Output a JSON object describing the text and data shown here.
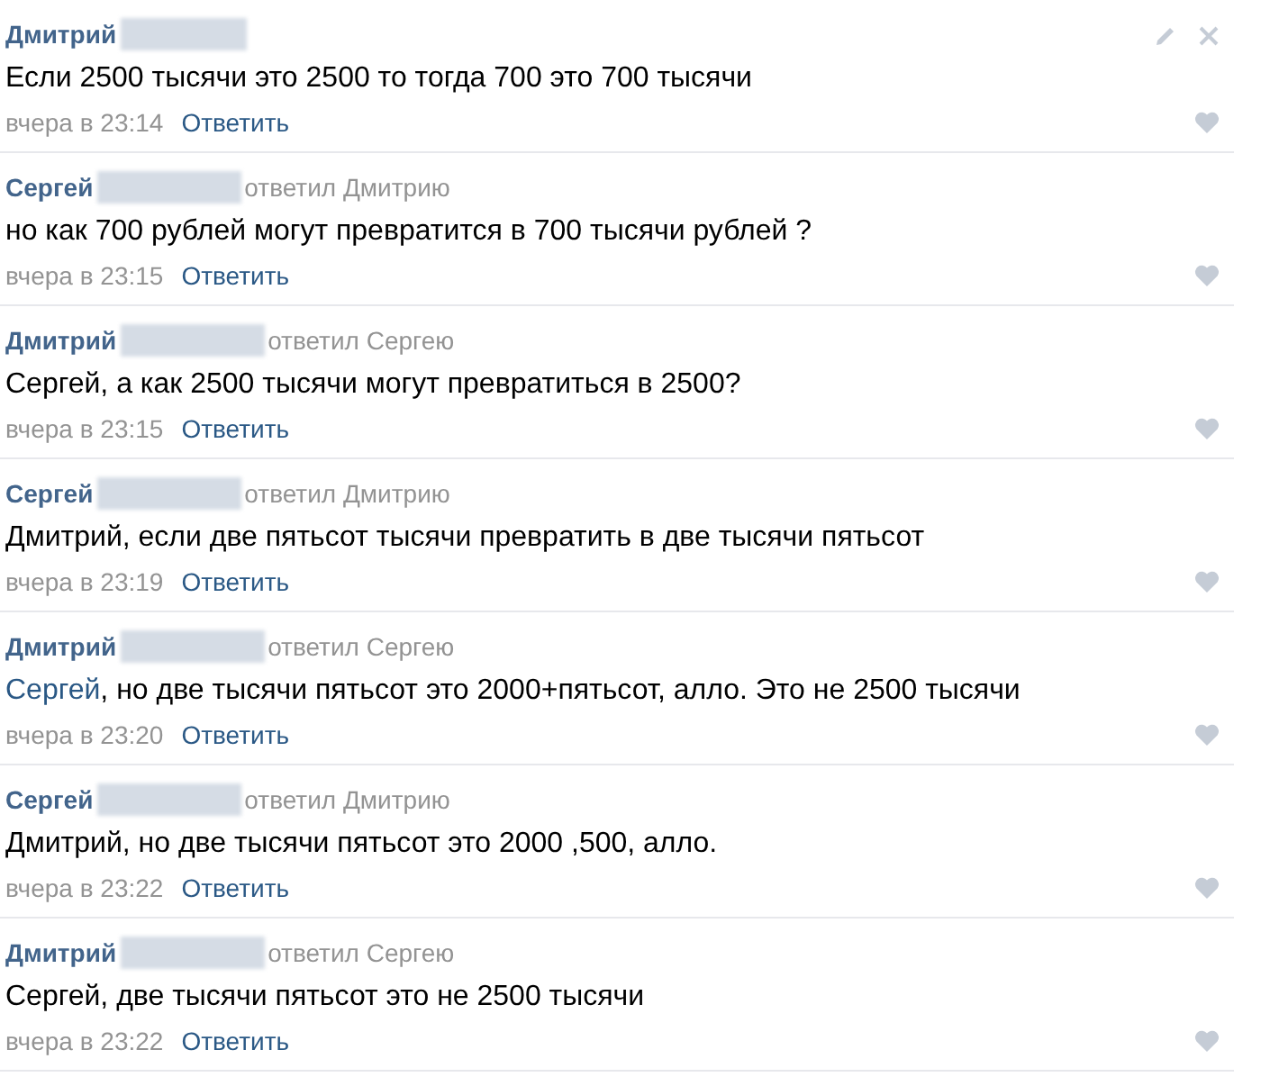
{
  "comments": [
    {
      "author": "Дмитрий",
      "text": "Если 2500 тысячи это 2500 то тогда 700 это 700 тысячи",
      "time": "вчера в 23:14",
      "reply_label": "Ответить",
      "editable": true,
      "liked": false
    },
    {
      "author": "Сергей",
      "reply_to": "ответил Дмитрию",
      "text": "но как 700 рублей могут превратится в 700 тысячи рублей ?",
      "time": "вчера в 23:15",
      "reply_label": "Ответить",
      "editable": false,
      "liked": false
    },
    {
      "author": "Дмитрий",
      "reply_to": "ответил Сергею",
      "text": "Сергей, а как 2500 тысячи могут превратиться в 2500?",
      "time": "вчера в 23:15",
      "reply_label": "Ответить",
      "editable": false,
      "liked": false
    },
    {
      "author": "Сергей",
      "reply_to": "ответил Дмитрию",
      "text": "Дмитрий, если две пятьсот тысячи превратить в две тысячи пятьсот",
      "time": "вчера в 23:19",
      "reply_label": "Ответить",
      "editable": false,
      "liked": false
    },
    {
      "author": "Дмитрий",
      "reply_to": "ответил Сергею",
      "mention": "Сергей",
      "text": ", но две тысячи пятьсот это 2000+пятьсот, алло. Это не 2500 тысячи",
      "time": "вчера в 23:20",
      "reply_label": "Ответить",
      "editable": false,
      "liked": false
    },
    {
      "author": "Сергей",
      "reply_to": "ответил Дмитрию",
      "text": "Дмитрий, но две тысячи пятьсот это 2000 ,500, алло.",
      "time": "вчера в 23:22",
      "reply_label": "Ответить",
      "editable": false,
      "liked": false
    },
    {
      "author": "Дмитрий",
      "reply_to": "ответил Сергею",
      "text": "Сергей, две тысячи пятьсот это не 2500 тысячи",
      "time": "вчера в 23:22",
      "reply_label": "Ответить",
      "editable": false,
      "liked": false
    }
  ]
}
